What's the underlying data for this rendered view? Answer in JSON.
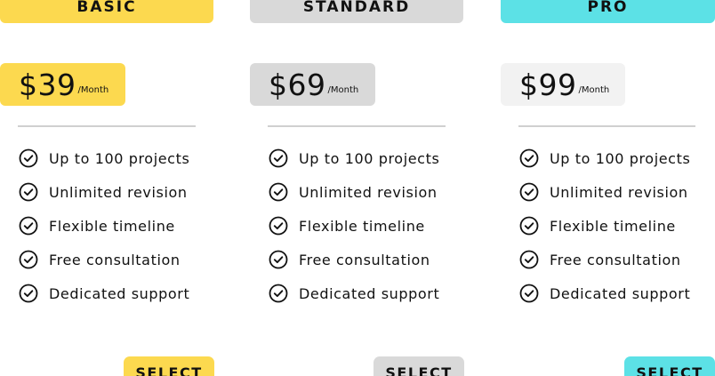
{
  "colors": {
    "basic_accent": "#fcd94f",
    "standard_accent": "#d9d9d9",
    "pro_accent": "#5ce1e6",
    "pro_price_bg": "#f2f2f2",
    "divider": "#d0d0d0",
    "text": "#111111"
  },
  "plans": [
    {
      "name": "BASIC",
      "price": "$39",
      "period": "/Month",
      "features": [
        "Up to 100 projects",
        "Unlimited revision",
        "Flexible timeline",
        "Free consultation",
        "Dedicated support"
      ],
      "button_label": "SELECT",
      "feature_icon": "check-circle-icon"
    },
    {
      "name": "STANDARD",
      "price": "$69",
      "period": "/Month",
      "features": [
        "Up to 100 projects",
        "Unlimited revision",
        "Flexible timeline",
        "Free consultation",
        "Dedicated support"
      ],
      "button_label": "SELECT",
      "feature_icon": "check-circle-icon"
    },
    {
      "name": "PRO",
      "price": "$99",
      "period": "/Month",
      "features": [
        "Up to 100 projects",
        "Unlimited revision",
        "Flexible timeline",
        "Free consultation",
        "Dedicated support"
      ],
      "button_label": "SELECT",
      "feature_icon": "check-circle-icon"
    }
  ]
}
